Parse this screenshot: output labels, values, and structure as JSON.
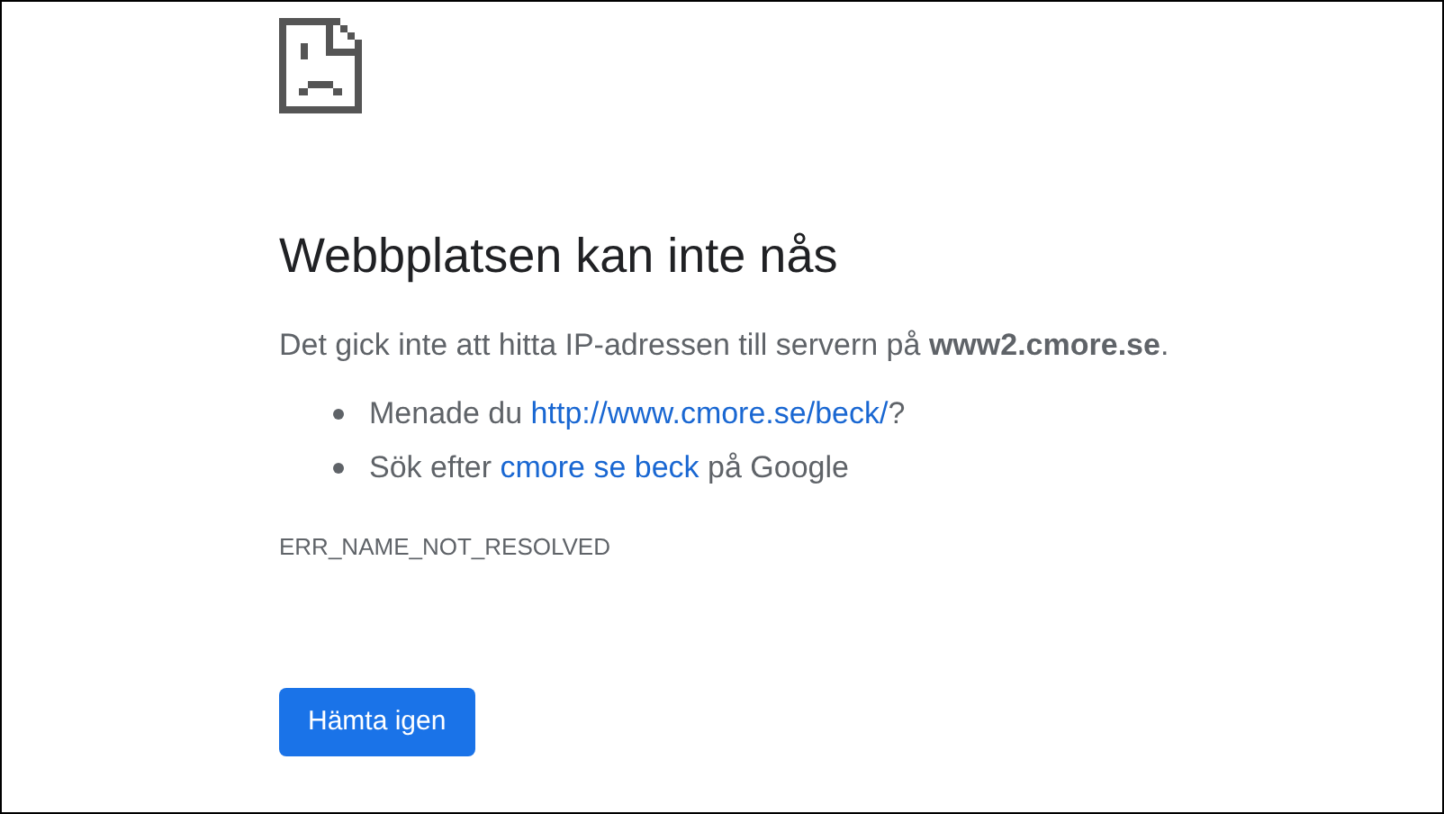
{
  "heading": "Webbplatsen kan inte nås",
  "message": "Det gick inte att hitta IP-adressen till servern på **www2.cmore.se**.",
  "suggestions": [
    {
      "before": "Menade du ",
      "link": "http://www.cmore.se/beck/",
      "after": "?"
    },
    {
      "before": "Sök efter ",
      "link": "cmore se beck",
      "after": " på Google"
    }
  ],
  "error_code": "ERR_NAME_NOT_RESOLVED",
  "reload_button": "Hämta igen"
}
